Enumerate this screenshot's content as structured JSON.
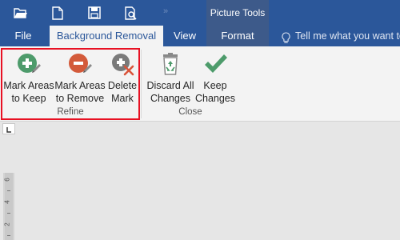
{
  "quick_access": {
    "items": [
      "open-icon",
      "new-document-icon",
      "save-icon",
      "print-preview-icon"
    ],
    "overflow_glyph": "»"
  },
  "context_group": {
    "label": "Picture Tools",
    "color": "#3d5a8a"
  },
  "tabs": {
    "file": "File",
    "background_removal": "Background Removal",
    "view": "View",
    "format": "Format"
  },
  "tell_me": {
    "placeholder": "Tell me what you want to"
  },
  "ribbon": {
    "refine": {
      "label": "Refine",
      "mark_keep": {
        "line1": "Mark Areas",
        "line2": "to Keep",
        "icon": "plus-pencil-icon"
      },
      "mark_remove": {
        "line1": "Mark Areas",
        "line2": "to Remove",
        "icon": "minus-pencil-icon"
      },
      "delete_mark": {
        "line1": "Delete",
        "line2": "Mark",
        "icon": "delete-mark-icon"
      }
    },
    "close": {
      "label": "Close",
      "discard": {
        "line1": "Discard All",
        "line2": "Changes",
        "icon": "recycle-bin-icon"
      },
      "keep": {
        "line1": "Keep",
        "line2": "Changes",
        "icon": "checkmark-icon"
      }
    }
  },
  "ruler": {
    "numbers": [
      "6",
      "4",
      "2"
    ]
  },
  "colors": {
    "title_bar": "#2b579a",
    "ribbon": "#f3f3f3",
    "highlight": "#e81123",
    "keep_green": "#4d9b6b",
    "remove_red": "#d35a3a"
  }
}
